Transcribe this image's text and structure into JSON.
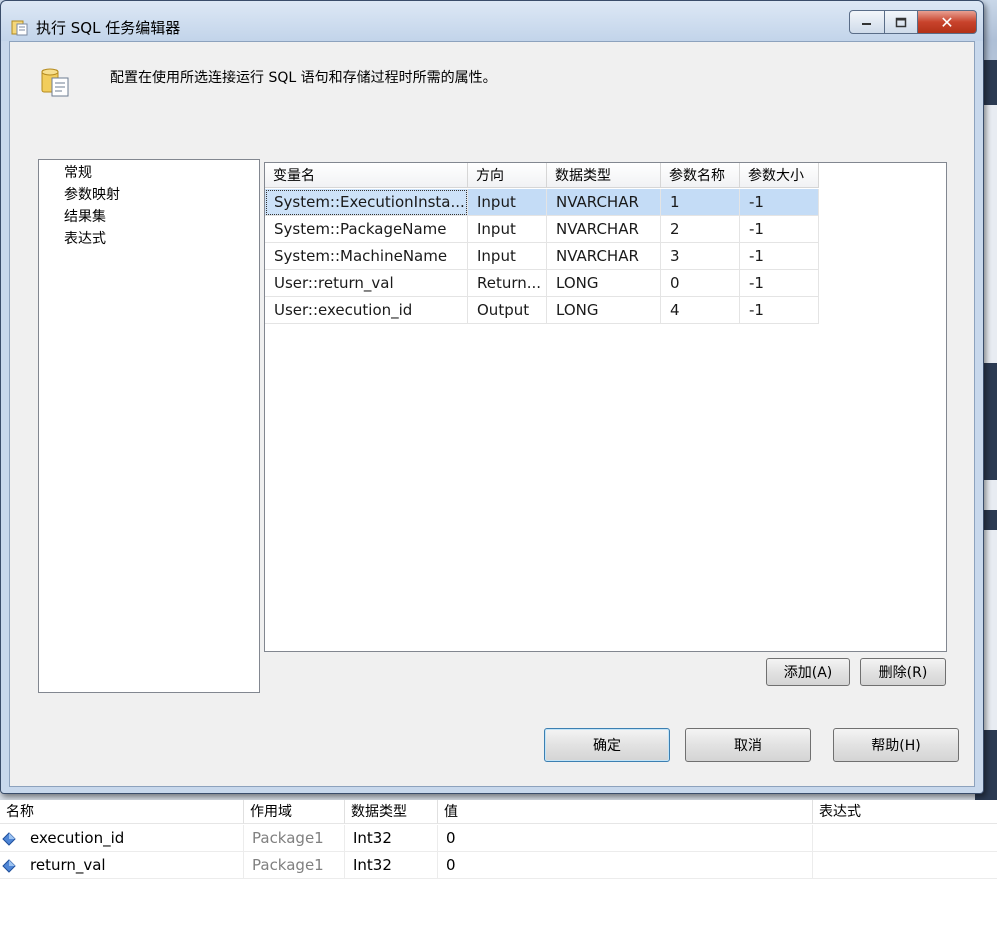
{
  "window": {
    "title": "执行 SQL 任务编辑器",
    "description": "配置在使用所选连接运行 SQL 语句和存储过程时所需的属性。",
    "close_glyph": "✕"
  },
  "nav": {
    "items": [
      "常规",
      "参数映射",
      "结果集",
      "表达式"
    ]
  },
  "grid": {
    "headers": [
      "变量名",
      "方向",
      "数据类型",
      "参数名称",
      "参数大小"
    ],
    "rows": [
      [
        "System::ExecutionInsta...",
        "Input",
        "NVARCHAR",
        "1",
        "-1"
      ],
      [
        "System::PackageName",
        "Input",
        "NVARCHAR",
        "2",
        "-1"
      ],
      [
        "System::MachineName",
        "Input",
        "NVARCHAR",
        "3",
        "-1"
      ],
      [
        "User::return_val",
        "Return...",
        "LONG",
        "0",
        "-1"
      ],
      [
        "User::execution_id",
        "Output",
        "LONG",
        "4",
        "-1"
      ]
    ],
    "selected_row": 0
  },
  "buttons": {
    "add": "添加(A)",
    "delete": "删除(R)",
    "ok": "确定",
    "cancel": "取消",
    "help": "帮助(H)"
  },
  "variables_pane": {
    "headers": [
      "名称",
      "作用域",
      "数据类型",
      "值",
      "表达式"
    ],
    "rows": [
      [
        "execution_id",
        "Package1",
        "Int32",
        "0",
        ""
      ],
      [
        "return_val",
        "Package1",
        "Int32",
        "0",
        ""
      ]
    ],
    "icon": "variable-icon"
  },
  "colors": {
    "selection": "#c4dcf6",
    "close_button": "#c8432c",
    "title_bar": "#c8d8ec"
  }
}
